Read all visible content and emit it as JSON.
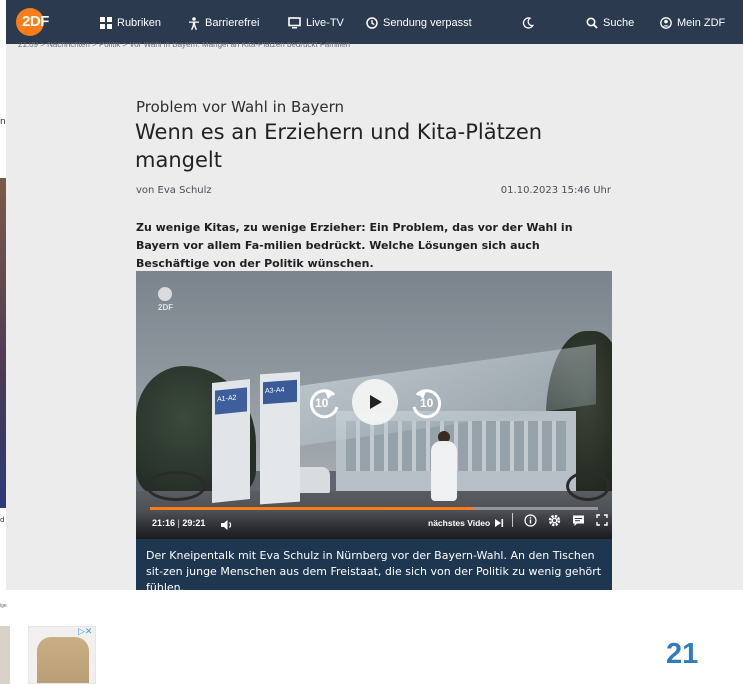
{
  "nav": {
    "logo": "2DF",
    "items": [
      {
        "label": "Rubriken",
        "icon": "grid-icon"
      },
      {
        "label": "Barrierefrei",
        "icon": "accessibility-icon"
      },
      {
        "label": "Live-TV",
        "icon": "tv-icon"
      },
      {
        "label": "Sendung verpasst",
        "icon": "clock-icon"
      },
      {
        "label": "",
        "icon": "moon-icon"
      },
      {
        "label": "Suche",
        "icon": "search-icon"
      },
      {
        "label": "Mein ZDF",
        "icon": "user-icon"
      }
    ]
  },
  "breadcrumb": "21.09 > Nachrichten > Politik > Vor Wahl in Bayern: Mangel an Kita-Plätzen bedrückt Familien",
  "article": {
    "kicker": "Problem vor Wahl in Bayern",
    "headline": "Wenn es an Erziehern und Kita-Plätzen mangelt",
    "byline": "von Eva Schulz",
    "date": "01.10.2023 15:46 Uhr",
    "lead": "Zu wenige Kitas, zu wenige Erzieher: Ein Problem, das vor der Wahl in Bayern vor allem Fa-milien bedrückt. Welche Lösungen sich auch Beschäftige von der Politik wünschen."
  },
  "video": {
    "logo": "2DF",
    "rewind": "10",
    "forward": "10",
    "current_time": "21:16",
    "separator": "|",
    "duration": "29:21",
    "progress": 0.724,
    "next_label": "nächstes Video",
    "signs": [
      "A1-A2",
      "A3-A4"
    ],
    "caption": "Der Kneipentalk mit Eva Schulz in Nürnberg vor der Bayern-Wahl. An den Tischen sit-zen junge Menschen aus dem Freistaat, die sich von der Politik zu wenig gehört fühlen."
  },
  "background": {
    "left_fragment_top": "n",
    "left_fragment_bottom": "d",
    "ad_label": "ige",
    "ad_choice": "▷✕",
    "page_number": "21"
  },
  "colors": {
    "nav_bg": "#2b3a4e",
    "brand_orange": "#fa7d19",
    "caption_bg": "#1f3650",
    "page_number": "#2f7bbf"
  }
}
